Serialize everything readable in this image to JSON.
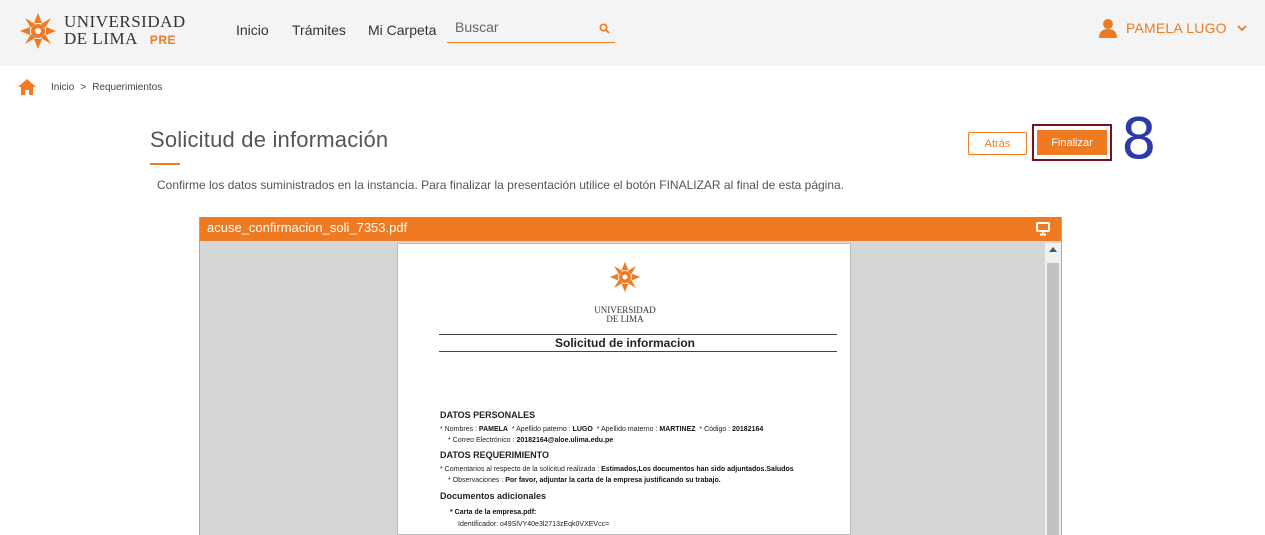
{
  "brand": {
    "line1": "UNIVERSIDAD",
    "line2": "DE LIMA",
    "tag": "PRE"
  },
  "nav": {
    "inicio": "Inicio",
    "tramites": "Trámites",
    "carpeta": "Mi Carpeta"
  },
  "search": {
    "placeholder": "Buscar"
  },
  "user": {
    "name": "PAMELA LUGO"
  },
  "breadcrumb": {
    "home": "Inicio",
    "separator": ">",
    "current": "Requerimientos"
  },
  "page": {
    "title": "Solicitud de información",
    "subtitle": "Confirme los datos suministrados en la instancia. Para finalizar la presentación utilice el botón FINALIZAR al final de esta página."
  },
  "actions": {
    "back": "Atrás",
    "finish": "Finalizar",
    "step": "8"
  },
  "viewer": {
    "filename": "acuse_confirmacion_soli_7353.pdf",
    "doc": {
      "univ_line1": "UNIVERSIDAD",
      "univ_line2": "DE LIMA",
      "title": "Solicitud de informacion",
      "personal_heading": "DATOS PERSONALES",
      "nombres_label": "* Nombres :",
      "nombres_value": "PAMELA",
      "paterno_label": "* Apellido paterno :",
      "paterno_value": "LUGO",
      "materno_label": "* Apellido materno :",
      "materno_value": "MARTINEZ",
      "codigo_label": "* Código :",
      "codigo_value": "20182164",
      "correo_label": "* Correo Electrónico :",
      "correo_value": "20182164@aloe.ulima.edu.pe",
      "req_heading": "DATOS REQUERIMIENTO",
      "comentarios_label": "* Comentarios al respecto de la solicitud realizada :",
      "comentarios_value": "Estimados,Los documentos han sido adjuntados.Saludos",
      "obs_label": "* Observaciones :",
      "obs_value": "Por favor, adjuntar la carta de la empresa justificando su trabajo.",
      "docs_heading": "Documentos adicionales",
      "file_label": "* Carta de la empresa.pdf:",
      "file_id": "Identificador: o49SlVY40e3l2713zEqk0VXEVcc="
    }
  },
  "colors": {
    "accent": "#f07a22",
    "highlight": "#7a1020",
    "step": "#2b3aa8"
  }
}
